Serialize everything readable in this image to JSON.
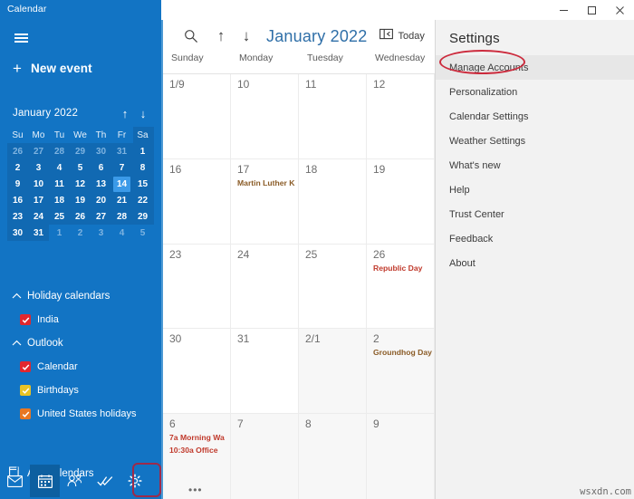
{
  "window": {
    "app_title": "Calendar",
    "controls": [
      {
        "name": "minimize",
        "glyph": "minimize-icon"
      },
      {
        "name": "maximize",
        "glyph": "maximize-icon"
      },
      {
        "name": "close",
        "glyph": "close-icon"
      }
    ]
  },
  "sidebar": {
    "hamburger_label": "hamburger-menu",
    "new_event": {
      "plus": "+",
      "label": "New event"
    },
    "mini_calendar": {
      "month_label": "January 2022",
      "prev_arrow": "↑",
      "next_arrow": "↓",
      "dow": [
        "Su",
        "Mo",
        "Tu",
        "We",
        "Th",
        "Fr",
        "Sa"
      ],
      "selected_day": "14",
      "weeks": [
        [
          {
            "d": "26",
            "o": true
          },
          {
            "d": "27",
            "o": true
          },
          {
            "d": "28",
            "o": true
          },
          {
            "d": "29",
            "o": true
          },
          {
            "d": "30",
            "o": true
          },
          {
            "d": "31",
            "o": true
          },
          {
            "d": "1",
            "o": false
          }
        ],
        [
          {
            "d": "2",
            "o": false
          },
          {
            "d": "3",
            "o": false
          },
          {
            "d": "4",
            "o": false
          },
          {
            "d": "5",
            "o": false
          },
          {
            "d": "6",
            "o": false
          },
          {
            "d": "7",
            "o": false
          },
          {
            "d": "8",
            "o": false
          }
        ],
        [
          {
            "d": "9",
            "o": false
          },
          {
            "d": "10",
            "o": false
          },
          {
            "d": "11",
            "o": false
          },
          {
            "d": "12",
            "o": false
          },
          {
            "d": "13",
            "o": false
          },
          {
            "d": "14",
            "o": false,
            "sel": true
          },
          {
            "d": "15",
            "o": false
          }
        ],
        [
          {
            "d": "16",
            "o": false
          },
          {
            "d": "17",
            "o": false
          },
          {
            "d": "18",
            "o": false
          },
          {
            "d": "19",
            "o": false
          },
          {
            "d": "20",
            "o": false
          },
          {
            "d": "21",
            "o": false
          },
          {
            "d": "22",
            "o": false
          }
        ],
        [
          {
            "d": "23",
            "o": false
          },
          {
            "d": "24",
            "o": false
          },
          {
            "d": "25",
            "o": false
          },
          {
            "d": "26",
            "o": false
          },
          {
            "d": "27",
            "o": false
          },
          {
            "d": "28",
            "o": false
          },
          {
            "d": "29",
            "o": false
          }
        ],
        [
          {
            "d": "30",
            "o": false
          },
          {
            "d": "31",
            "o": false
          },
          {
            "d": "1",
            "o": true
          },
          {
            "d": "2",
            "o": true
          },
          {
            "d": "3",
            "o": true
          },
          {
            "d": "4",
            "o": true
          },
          {
            "d": "5",
            "o": true
          }
        ]
      ]
    },
    "groups": [
      {
        "name": "Holiday calendars",
        "chevron": "⌃",
        "items": [
          {
            "label": "India",
            "color": "#e1272e"
          }
        ]
      },
      {
        "name": "Outlook",
        "chevron": "⌃",
        "items": [
          {
            "label": "Calendar",
            "color": "#e1272e"
          },
          {
            "label": "Birthdays",
            "color": "#e8c325"
          },
          {
            "label": "United States holidays",
            "color": "#e87722"
          }
        ]
      }
    ],
    "add_calendars_label": "Add calendars",
    "bottom_nav": [
      {
        "name": "mail-icon",
        "selected": false
      },
      {
        "name": "calendar-icon",
        "selected": true
      },
      {
        "name": "people-icon",
        "selected": false
      },
      {
        "name": "todo-icon",
        "selected": false
      },
      {
        "name": "settings-gear-icon",
        "selected": false
      }
    ]
  },
  "main": {
    "toolbar": {
      "search_icon": "search-icon",
      "prev_arrow": "↑",
      "next_arrow": "↓",
      "month_title": "January 2022",
      "today_label": "Today"
    },
    "day_headers": [
      "Sunday",
      "Monday",
      "Tuesday",
      "Wednesday"
    ],
    "weeks": [
      [
        {
          "num": "1/9",
          "other": false,
          "events": []
        },
        {
          "num": "10",
          "other": false,
          "events": []
        },
        {
          "num": "11",
          "other": false,
          "events": []
        },
        {
          "num": "12",
          "other": false,
          "events": []
        }
      ],
      [
        {
          "num": "16",
          "other": false,
          "events": []
        },
        {
          "num": "17",
          "other": false,
          "events": [
            {
              "text": "Martin Luther K",
              "color": "#8a5b26"
            }
          ]
        },
        {
          "num": "18",
          "other": false,
          "events": []
        },
        {
          "num": "19",
          "other": false,
          "events": []
        }
      ],
      [
        {
          "num": "23",
          "other": false,
          "events": []
        },
        {
          "num": "24",
          "other": false,
          "events": []
        },
        {
          "num": "25",
          "other": false,
          "events": []
        },
        {
          "num": "26",
          "other": false,
          "events": [
            {
              "text": "Republic Day",
              "color": "#c0392b"
            }
          ]
        }
      ],
      [
        {
          "num": "30",
          "other": false,
          "events": []
        },
        {
          "num": "31",
          "other": false,
          "events": []
        },
        {
          "num": "2/1",
          "other": true,
          "events": []
        },
        {
          "num": "2",
          "other": true,
          "events": [
            {
              "text": "Groundhog Day",
              "color": "#8a5b26"
            }
          ]
        }
      ],
      [
        {
          "num": "6",
          "other": true,
          "events": [
            {
              "text": "7a Morning Wa",
              "color": "#c0392b"
            },
            {
              "text": "10:30a Office",
              "color": "#c0392b"
            }
          ],
          "more": "•••"
        },
        {
          "num": "7",
          "other": true,
          "events": []
        },
        {
          "num": "8",
          "other": true,
          "events": []
        },
        {
          "num": "9",
          "other": true,
          "events": []
        }
      ]
    ]
  },
  "settings": {
    "title": "Settings",
    "items": [
      {
        "label": "Manage Accounts",
        "active": true
      },
      {
        "label": "Personalization",
        "active": false
      },
      {
        "label": "Calendar Settings",
        "active": false
      },
      {
        "label": "Weather Settings",
        "active": false
      },
      {
        "label": "What's new",
        "active": false
      },
      {
        "label": "Help",
        "active": false
      },
      {
        "label": "Trust Center",
        "active": false
      },
      {
        "label": "Feedback",
        "active": false
      },
      {
        "label": "About",
        "active": false
      }
    ]
  },
  "annotations": {
    "manage_accounts_highlight_color": "#cc2b3d",
    "gear_highlight_color": "#9e2a4a"
  },
  "watermark": "wsxdn.com"
}
